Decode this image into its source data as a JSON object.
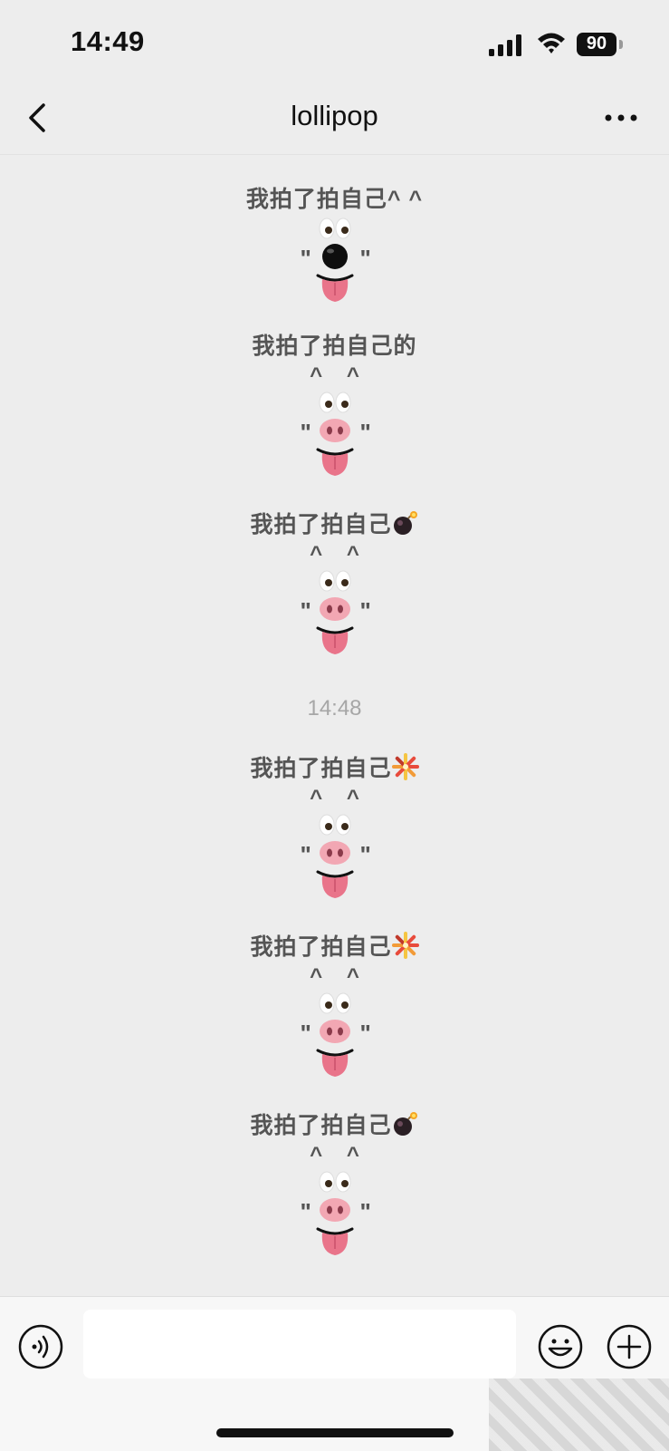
{
  "status_bar": {
    "time": "14:49",
    "battery": "90"
  },
  "nav": {
    "title": "lollipop"
  },
  "messages": [
    {
      "text": "我拍了拍自己^  ^",
      "carets": "",
      "nose": "black",
      "suffix_icon": ""
    },
    {
      "text": "我拍了拍自己的",
      "carets": "^  ^",
      "nose": "pig",
      "suffix_icon": ""
    },
    {
      "text": "我拍了拍自己",
      "carets": "^  ^",
      "nose": "pig",
      "suffix_icon": "bomb-icon"
    },
    {
      "text": "我拍了拍自己",
      "carets": "^  ^",
      "nose": "pig",
      "suffix_icon": "firecracker-icon"
    },
    {
      "text": "我拍了拍自己",
      "carets": "^  ^",
      "nose": "pig",
      "suffix_icon": "firecracker-icon"
    },
    {
      "text": "我拍了拍自己",
      "carets": "^  ^",
      "nose": "pig",
      "suffix_icon": "bomb-icon"
    }
  ],
  "timestamp": "14:48",
  "quote_char": "\"",
  "input": {
    "placeholder": ""
  },
  "colors": {
    "background": "#ededed",
    "system_text": "#555555",
    "timestamp": "#a6a6a6",
    "tongue": "#e9748a",
    "pig_nose": "#f2a7b3"
  }
}
